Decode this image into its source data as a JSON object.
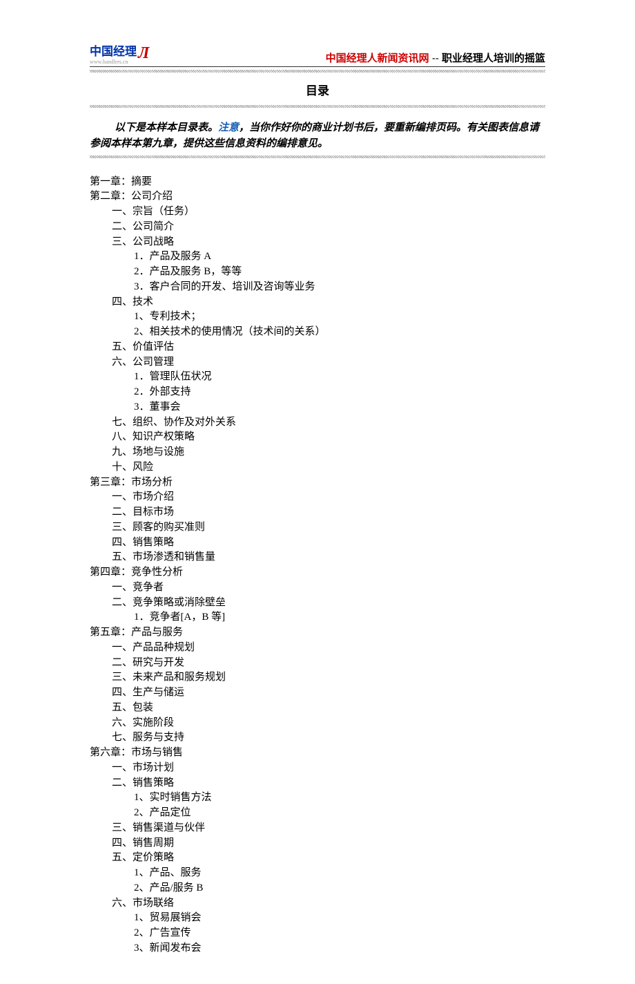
{
  "header": {
    "logo_text": "中国经理",
    "logo_sub": "www.handlers.cn",
    "logo_mark": "Л",
    "site": "中国经理人新闻资讯网",
    "sep": " -- ",
    "tagline": "职业经理人培训的摇篮"
  },
  "title": "目录",
  "intro": {
    "part1": "以下是本样本目录表。",
    "note": "注意",
    "part2": "，当你作好你的商业计划书后，要重新编排页码。有关图表信息请参阅本样本第九章，提供这些信息资料的编排意见。"
  },
  "toc": [
    {
      "level": 0,
      "text": "第一章：摘要"
    },
    {
      "level": 0,
      "text": "第二章：公司介绍"
    },
    {
      "level": 1,
      "text": "一、宗旨（任务）"
    },
    {
      "level": 1,
      "text": "二、公司简介"
    },
    {
      "level": 1,
      "text": "三、公司战略"
    },
    {
      "level": 2,
      "text": "1．产品及服务 A"
    },
    {
      "level": 2,
      "text": "2．产品及服务 B，等等"
    },
    {
      "level": 2,
      "text": "3．客户合同的开发、培训及咨询等业务"
    },
    {
      "level": 1,
      "text": "四、技术"
    },
    {
      "level": 2,
      "text": "1、专利技术；"
    },
    {
      "level": 2,
      "text": "2、相关技术的使用情况（技术间的关系）"
    },
    {
      "level": 1,
      "text": "五、价值评估"
    },
    {
      "level": 1,
      "text": "六、公司管理"
    },
    {
      "level": 2,
      "text": "1．管理队伍状况"
    },
    {
      "level": 2,
      "text": "2．外部支持"
    },
    {
      "level": 2,
      "text": "3．董事会"
    },
    {
      "level": 1,
      "text": "七、组织、协作及对外关系"
    },
    {
      "level": 1,
      "text": "八、知识产权策略"
    },
    {
      "level": 1,
      "text": "九、场地与设施"
    },
    {
      "level": 1,
      "text": "十、风险"
    },
    {
      "level": 0,
      "text": "第三章：市场分析"
    },
    {
      "level": 1,
      "text": "一、市场介绍"
    },
    {
      "level": 1,
      "text": "二、目标市场"
    },
    {
      "level": 1,
      "text": "三、顾客的购买准则"
    },
    {
      "level": 1,
      "text": "四、销售策略"
    },
    {
      "level": 1,
      "text": "五、市场渗透和销售量"
    },
    {
      "level": 0,
      "text": "第四章：竞争性分析"
    },
    {
      "level": 1,
      "text": "一、竞争者"
    },
    {
      "level": 1,
      "text": "二、竞争策略或消除壁垒"
    },
    {
      "level": 2,
      "text": "1．竞争者[A，B 等]"
    },
    {
      "level": 0,
      "text": "第五章：产品与服务"
    },
    {
      "level": 1,
      "text": "一、产品品种规划"
    },
    {
      "level": 1,
      "text": "二、研究与开发"
    },
    {
      "level": 1,
      "text": "三、未来产品和服务规划"
    },
    {
      "level": 1,
      "text": "四、生产与储运"
    },
    {
      "level": 1,
      "text": "五、包装"
    },
    {
      "level": 1,
      "text": "六、实施阶段"
    },
    {
      "level": 1,
      "text": "七、服务与支持"
    },
    {
      "level": 0,
      "text": "第六章：市场与销售"
    },
    {
      "level": 1,
      "text": "一、市场计划"
    },
    {
      "level": 1,
      "text": "二、销售策略"
    },
    {
      "level": 2,
      "text": "1、实时销售方法"
    },
    {
      "level": 2,
      "text": "2、产品定位"
    },
    {
      "level": 1,
      "text": "三、销售渠道与伙伴"
    },
    {
      "level": 1,
      "text": "四、销售周期"
    },
    {
      "level": 1,
      "text": "五、定价策略"
    },
    {
      "level": 2,
      "text": "1、产品、服务"
    },
    {
      "level": 2,
      "text": "2、产品/服务 B"
    },
    {
      "level": 1,
      "text": "六、市场联络"
    },
    {
      "level": 2,
      "text": "1、贸易展销会"
    },
    {
      "level": 2,
      "text": "2、广告宣传"
    },
    {
      "level": 2,
      "text": "3、新闻发布会"
    }
  ]
}
